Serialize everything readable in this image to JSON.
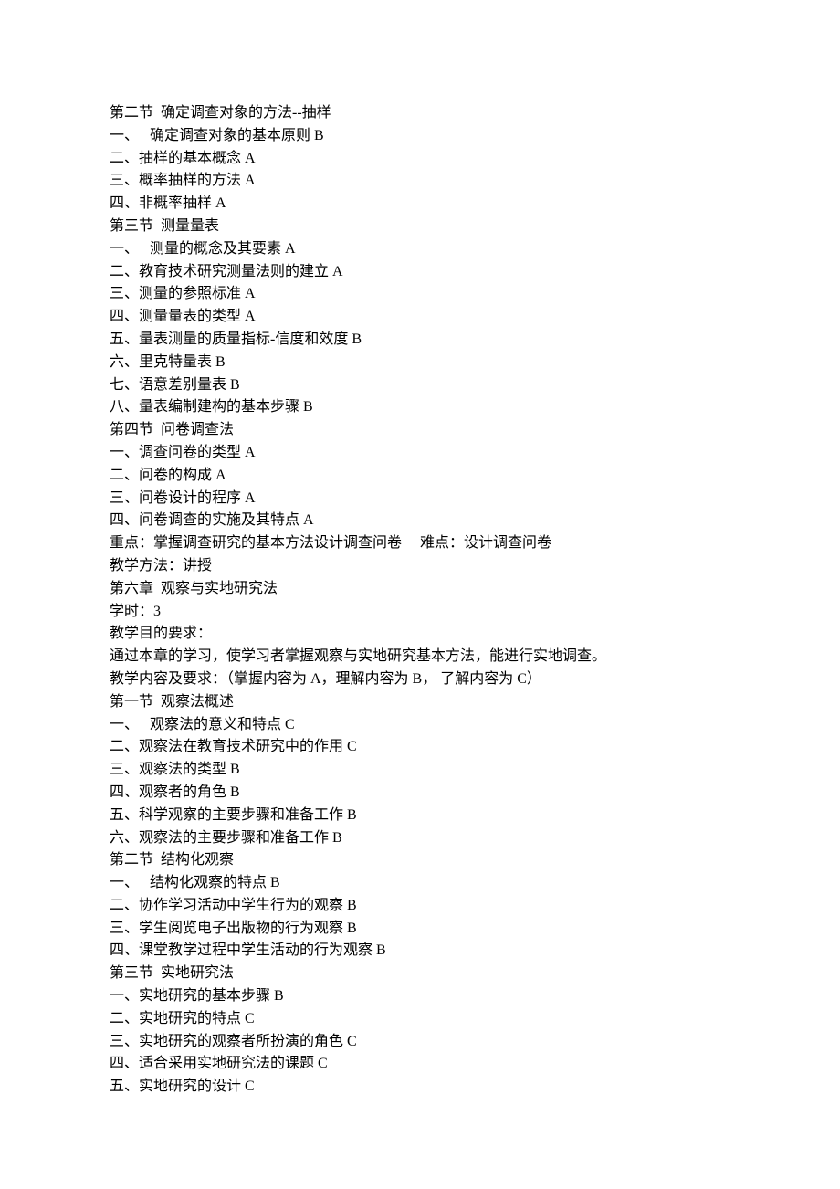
{
  "lines": [
    "第二节  确定调查对象的方法--抽样",
    "一、   确定调查对象的基本原则 B",
    "二、抽样的基本概念 A",
    "三、概率抽样的方法 A",
    "四、非概率抽样 A",
    "第三节  测量量表",
    "一、   测量的概念及其要素 A",
    "二、教育技术研究测量法则的建立 A",
    "三、测量的参照标准 A",
    "四、测量量表的类型 A",
    "五、量表测量的质量指标-信度和效度 B",
    "六、里克特量表 B",
    "七、语意差别量表 B",
    "八、量表编制建构的基本步骤 B",
    "第四节  问卷调查法",
    "一、调查问卷的类型 A",
    "二、问卷的构成 A",
    "三、问卷设计的程序 A",
    "四、问卷调查的实施及其特点 A",
    "重点：掌握调查研究的基本方法设计调查问卷     难点：设计调查问卷",
    "教学方法：讲授",
    "第六章  观察与实地研究法",
    "学时：3",
    "教学目的要求：",
    "通过本章的学习，使学习者掌握观察与实地研究基本方法，能进行实地调查。",
    "教学内容及要求：（掌握内容为 A，理解内容为 B， 了解内容为 C）",
    "第一节  观察法概述",
    "一、   观察法的意义和特点 C",
    "二、观察法在教育技术研究中的作用 C",
    "三、观察法的类型 B",
    "四、观察者的角色 B",
    "五、科学观察的主要步骤和准备工作 B",
    "六、观察法的主要步骤和准备工作 B",
    "第二节  结构化观察",
    "一、   结构化观察的特点 B",
    "二、协作学习活动中学生行为的观察 B",
    "三、学生阅览电子出版物的行为观察 B",
    "四、课堂教学过程中学生活动的行为观察 B",
    "第三节  实地研究法",
    "一、实地研究的基本步骤 B",
    "二、实地研究的特点 C",
    "三、实地研究的观察者所扮演的角色 C",
    "四、适合采用实地研究法的课题 C",
    "五、实地研究的设计 C"
  ]
}
